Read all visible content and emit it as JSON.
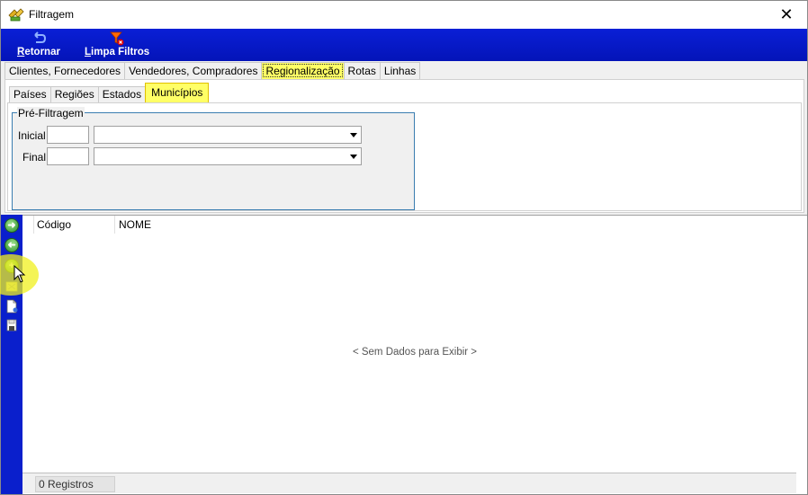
{
  "window": {
    "title": "Filtragem",
    "close_label": "✕"
  },
  "toolbar": {
    "retornar": {
      "hotkey": "R",
      "rest": "etornar",
      "icon": "return-arrow-icon"
    },
    "limpa_filtros": {
      "hotkey": "L",
      "rest": "impa Filtros",
      "icon": "funnel-clear-icon"
    }
  },
  "tabs_main": [
    {
      "label": "Clientes, Fornecedores",
      "active": false
    },
    {
      "label": "Vendedores, Compradores",
      "active": false
    },
    {
      "label": "Regionalização",
      "active": true
    },
    {
      "label": "Rotas",
      "active": false
    },
    {
      "label": "Linhas",
      "active": false
    }
  ],
  "tabs_sub": [
    {
      "label": "Países",
      "active": false
    },
    {
      "label": "Regiões",
      "active": false
    },
    {
      "label": "Estados",
      "active": false
    },
    {
      "label": "Municípios",
      "active": true
    }
  ],
  "prefiltro": {
    "legend": "Pré-Filtragem",
    "inicial_label": "Inicial",
    "final_label": "Final",
    "inicial_code": "",
    "final_code": "",
    "inicial_combo": "",
    "final_combo": ""
  },
  "sidebar_icons": [
    "arrow-right-icon",
    "arrow-left-icon",
    "add-icon",
    "remove-icon",
    "document-icon",
    "save-icon"
  ],
  "grid": {
    "columns": [
      "Código",
      "NOME"
    ],
    "empty_message": "< Sem Dados para Exibir >"
  },
  "footer": {
    "count_text": "0 Registros"
  },
  "colors": {
    "toolbar_blue": "#0a1fd6",
    "highlight_yellow": "#ffff66",
    "groupbox_border": "#3a7db0"
  }
}
